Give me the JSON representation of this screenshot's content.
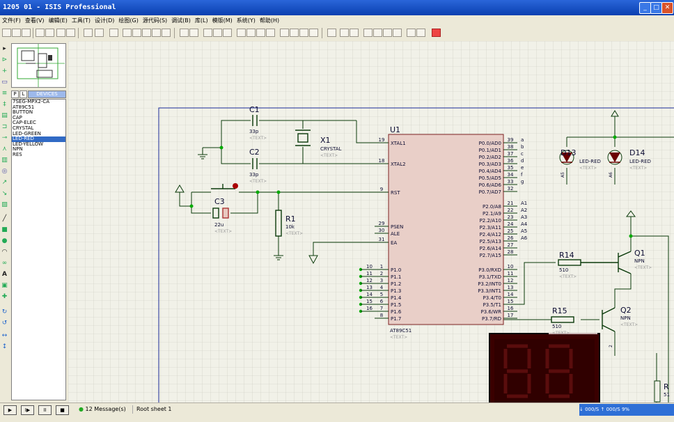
{
  "window": {
    "title": "1205 01 - ISIS Professional",
    "minimize_glyph": "_",
    "maximize_glyph": "□",
    "close_glyph": "✕"
  },
  "menu": [
    "文件(F)",
    "查看(V)",
    "编辑(E)",
    "工具(T)",
    "设计(D)",
    "绘图(G)",
    "源代码(S)",
    "调试(B)",
    "库(L)",
    "模版(M)",
    "系统(Y)",
    "帮助(H)"
  ],
  "device_tabs": {
    "p": "P",
    "l": "L",
    "devices": "DEVICES"
  },
  "devices": [
    "7SEG-MPX2-CA",
    "AT89C51",
    "BUTTON",
    "CAP",
    "CAP-ELEC",
    "CRYSTAL",
    "LED-GREEN",
    "LED-RED",
    "LED-YELLOW",
    "NPN",
    "RES"
  ],
  "selected_device": "LED-RED",
  "schematic": {
    "text_placeholder": "<TEXT>",
    "c1": {
      "ref": "C1",
      "value": "33p"
    },
    "c2": {
      "ref": "C2",
      "value": "33p"
    },
    "c3": {
      "ref": "C3",
      "value": "22u"
    },
    "x1": {
      "ref": "X1",
      "value": "CRYSTAL"
    },
    "r1": {
      "ref": "R1",
      "value": "10k"
    },
    "u1": {
      "ref": "U1",
      "part": "AT89C51"
    },
    "d13": {
      "ref": "D13",
      "value": "LED-RED",
      "net": "A5"
    },
    "d14": {
      "ref": "D14",
      "value": "LED-RED",
      "net": "A6"
    },
    "r14": {
      "ref": "R14",
      "value": "510"
    },
    "r15": {
      "ref": "R15",
      "value": "510"
    },
    "q1": {
      "ref": "Q1",
      "value": "NPN"
    },
    "q2": {
      "ref": "Q2",
      "value": "NPN"
    },
    "r_partial": {
      "ref": "R",
      "value": "51"
    },
    "left_pins": [
      {
        "num": "19",
        "name": "XTAL1"
      },
      {
        "num": "18",
        "name": "XTAL2"
      },
      {
        "num": "9",
        "name": "RST"
      },
      {
        "num": "29",
        "name": "PSEN"
      },
      {
        "num": "30",
        "name": "ALE"
      },
      {
        "num": "31",
        "name": "EA"
      },
      {
        "num": "1",
        "name": "P1.0"
      },
      {
        "num": "2",
        "name": "P1.1"
      },
      {
        "num": "3",
        "name": "P1.2"
      },
      {
        "num": "4",
        "name": "P1.3"
      },
      {
        "num": "5",
        "name": "P1.4"
      },
      {
        "num": "6",
        "name": "P1.5"
      },
      {
        "num": "7",
        "name": "P1.6"
      },
      {
        "num": "8",
        "name": "P1.7"
      }
    ],
    "left_labels": [
      "10",
      "11",
      "12",
      "13",
      "14",
      "15",
      "16"
    ],
    "right_pins": [
      {
        "num": "39",
        "name": "P0.0/AD0",
        "net": "a"
      },
      {
        "num": "38",
        "name": "P0.1/AD1",
        "net": "b"
      },
      {
        "num": "37",
        "name": "P0.2/AD2",
        "net": "c"
      },
      {
        "num": "36",
        "name": "P0.3/AD3",
        "net": "d"
      },
      {
        "num": "35",
        "name": "P0.4/AD4",
        "net": "e"
      },
      {
        "num": "34",
        "name": "P0.5/AD5",
        "net": "f"
      },
      {
        "num": "33",
        "name": "P0.6/AD6",
        "net": "g"
      },
      {
        "num": "32",
        "name": "P0.7/AD7",
        "net": ""
      },
      {
        "num": "21",
        "name": "P2.0/A8",
        "net": "A1"
      },
      {
        "num": "22",
        "name": "P2.1/A9",
        "net": "A2"
      },
      {
        "num": "23",
        "name": "P2.2/A10",
        "net": "A3"
      },
      {
        "num": "24",
        "name": "P2.3/A11",
        "net": "A4"
      },
      {
        "num": "25",
        "name": "P2.4/A12",
        "net": "A5"
      },
      {
        "num": "26",
        "name": "P2.5/A13",
        "net": "A6"
      },
      {
        "num": "27",
        "name": "P2.6/A14",
        "net": ""
      },
      {
        "num": "28",
        "name": "P2.7/A15",
        "net": ""
      },
      {
        "num": "10",
        "name": "P3.0/RXD",
        "net": ""
      },
      {
        "num": "11",
        "name": "P3.1/TXD",
        "net": ""
      },
      {
        "num": "12",
        "name": "P3.2/INT0",
        "net": ""
      },
      {
        "num": "13",
        "name": "P3.3/INT1",
        "net": ""
      },
      {
        "num": "14",
        "name": "P3.4/T0",
        "net": ""
      },
      {
        "num": "15",
        "name": "P3.5/T1",
        "net": ""
      },
      {
        "num": "16",
        "name": "P3.6/WR",
        "net": ""
      },
      {
        "num": "17",
        "name": "P3.7/RD",
        "net": ""
      }
    ],
    "q2_pin": "2"
  },
  "status": {
    "play": "▶",
    "step": "I▶",
    "pause": "II",
    "stop": "■",
    "messages": "12 Message(s)",
    "sheet": "Root sheet 1",
    "coords": "↓  000/S  ↑  000/S   9%"
  }
}
